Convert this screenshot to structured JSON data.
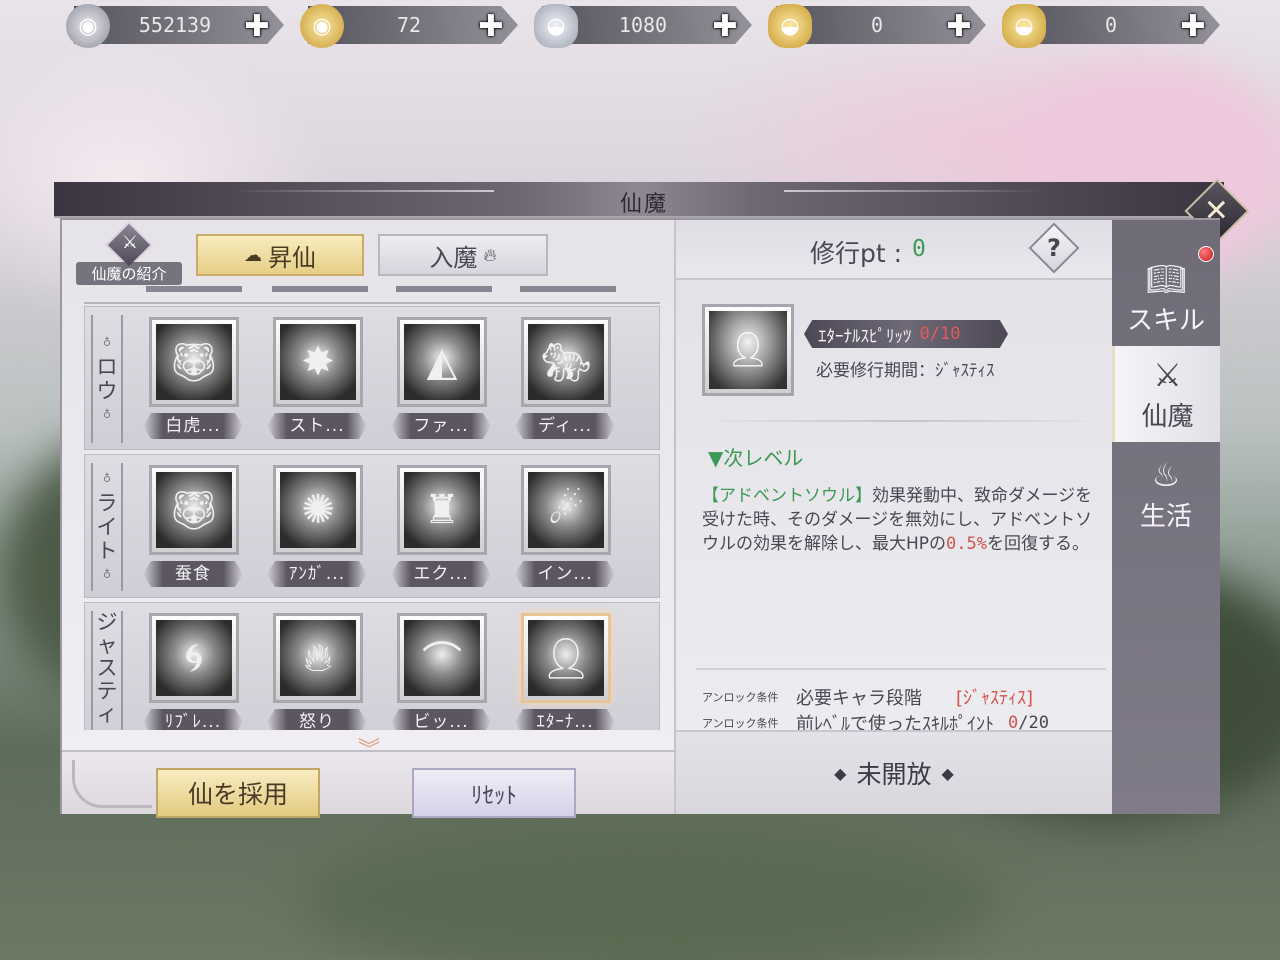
{
  "currencies": [
    {
      "icon": "silver-coin-icon",
      "value": "552139"
    },
    {
      "icon": "gold-coin-icon",
      "value": "72"
    },
    {
      "icon": "silver-ingot-icon",
      "value": "1080"
    },
    {
      "icon": "gold-ingot-bound-icon",
      "value": "0"
    },
    {
      "icon": "gold-ingot-icon",
      "value": "0"
    }
  ],
  "dialog": {
    "title": "仙魔",
    "intro_label": "仙魔の紹介",
    "tabs": {
      "ascend": "昇仙",
      "demon": "入魔"
    },
    "rows": [
      {
        "label": [
          "ロ",
          "ウ"
        ],
        "skills": [
          {
            "name": "白虎...",
            "icon": "tiger-icon"
          },
          {
            "name": "スト...",
            "icon": "light-burst-icon"
          },
          {
            "name": "ファ...",
            "icon": "fang-icon"
          },
          {
            "name": "ディ...",
            "icon": "roaring-tiger-icon"
          }
        ]
      },
      {
        "label": [
          "ラ",
          "イ",
          "ト"
        ],
        "skills": [
          {
            "name": "蚕食",
            "icon": "devour-tiger-icon"
          },
          {
            "name": "ｱﾝｶﾞ...",
            "icon": "explosion-icon"
          },
          {
            "name": "エク...",
            "icon": "jaws-figure-icon"
          },
          {
            "name": "イン...",
            "icon": "swirl-light-icon"
          }
        ]
      },
      {
        "label": [
          "ジ",
          "ャ",
          "ス",
          "テ",
          "ィ"
        ],
        "skills": [
          {
            "name": "ﾘﾌﾞﾚ...",
            "icon": "vortex-icon"
          },
          {
            "name": "怒り",
            "icon": "flame-icon"
          },
          {
            "name": "ビッ...",
            "icon": "serpent-icon"
          },
          {
            "name": "ｴﾀｰﾅ...",
            "icon": "spirit-figure-icon"
          }
        ]
      }
    ],
    "buttons": {
      "adopt": "仙を採用",
      "reset": "ﾘｾｯﾄ"
    }
  },
  "detail": {
    "pt_label": "修行pt :",
    "pt_value": "0",
    "help": "?",
    "skill_name": "ｴﾀｰﾅﾙｽﾋﾟﾘｯﾂ",
    "skill_progress": "0/10",
    "required_period": "必要修行期間：ｼﾞｬｽﾃｨｽ",
    "next_level": "▼次レベル",
    "description": {
      "tag": "【アドベントソウル】",
      "text_1": "効果発動中、致命ダメージを受けた時、そのダメージを無効にし、アドベントソウルの効果を解除し、最大HPの",
      "percent": "0.5%",
      "text_2": "を回復する。"
    },
    "unlock": [
      {
        "label": "アンロック条件",
        "text": "必要キャラ段階",
        "tag": "[ｼﾞｬｽﾃｨｽ]"
      },
      {
        "label": "アンロック条件",
        "text": "前ﾚﾍﾞﾙで使ったｽｷﾙﾎﾟｲﾝﾄ",
        "count_current": "0",
        "count_total": "/20"
      }
    ],
    "status": "未開放"
  },
  "side_tabs": [
    {
      "label": "スキル",
      "icon": "skill-book-icon",
      "active": false
    },
    {
      "label": "仙魔",
      "icon": "sword-emblem-icon",
      "active": true
    },
    {
      "label": "生活",
      "icon": "cooking-pot-icon",
      "active": false
    }
  ]
}
